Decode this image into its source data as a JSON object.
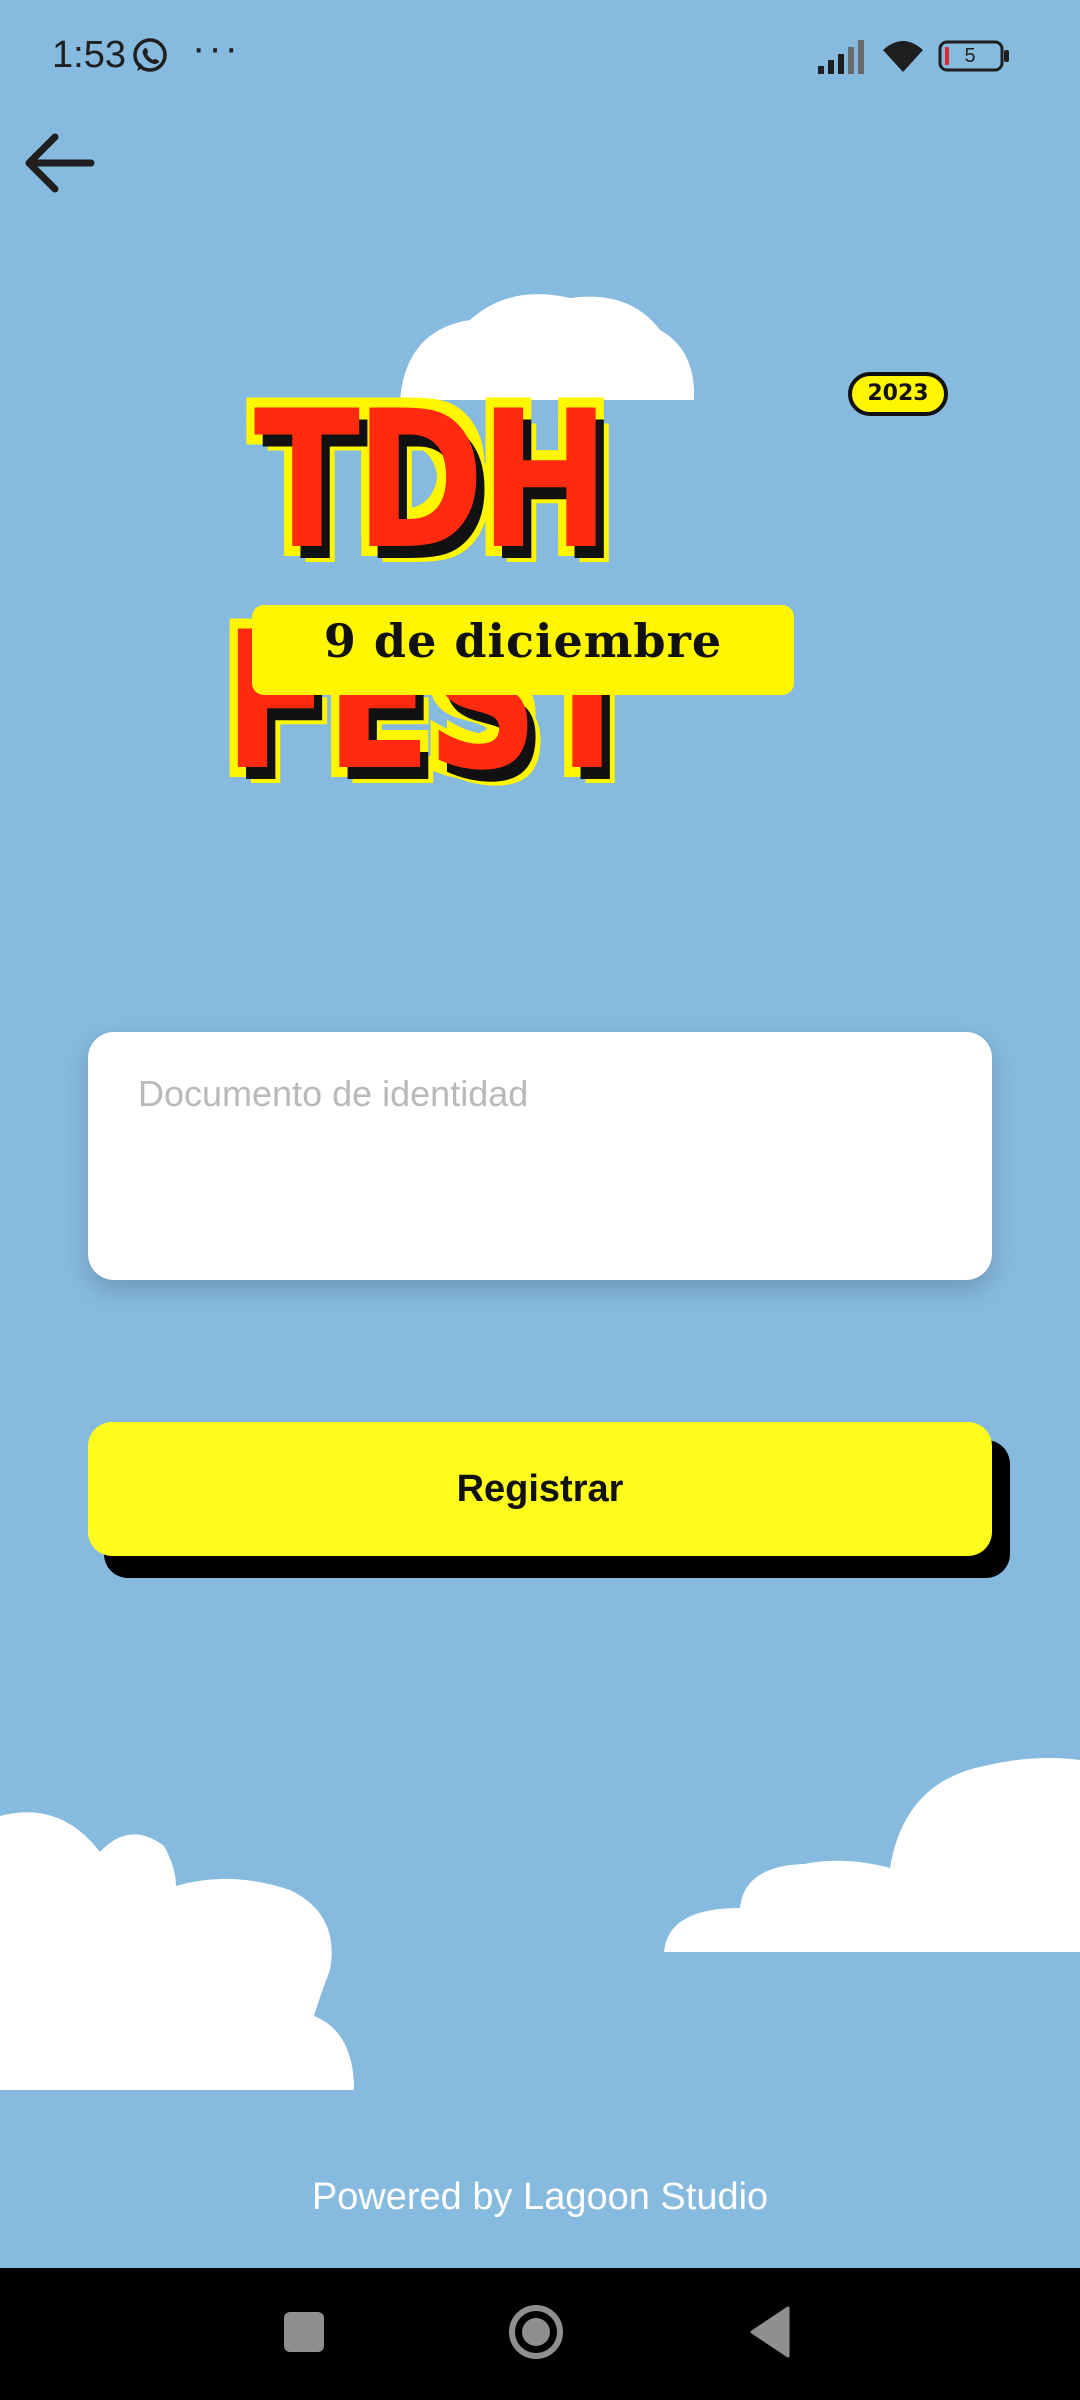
{
  "status_bar": {
    "time": "1:53",
    "more": "···",
    "battery_level": "5",
    "icons": [
      "whatsapp-icon",
      "signal-icon",
      "wifi-icon",
      "battery-icon"
    ]
  },
  "header": {
    "back_icon": "arrow-left-icon"
  },
  "logo": {
    "title": "TDH FEST",
    "year": "2023",
    "date": "9 de diciembre",
    "colors": {
      "fill": "#ff2a10",
      "outline": "#fff600",
      "shadow": "#111111"
    }
  },
  "form": {
    "document": {
      "placeholder": "Documento de identidad",
      "value": ""
    },
    "register_label": "Registrar"
  },
  "footer": {
    "powered_by": "Powered by Lagoon Studio"
  },
  "nav": {
    "icons": [
      "recents-icon",
      "home-icon",
      "back-icon"
    ]
  },
  "colors": {
    "background": "#86badf",
    "button": "#fffb1d",
    "button_shadow": "#000000",
    "card": "#ffffff"
  }
}
